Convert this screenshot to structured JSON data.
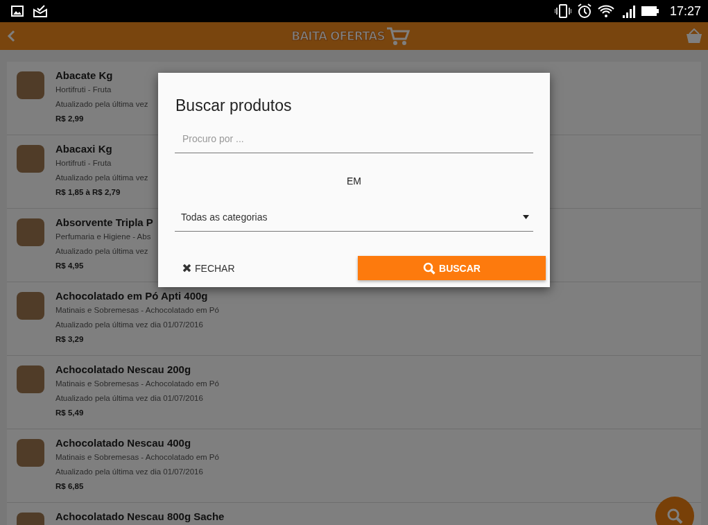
{
  "status_bar": {
    "time": "17:27"
  },
  "app_bar": {
    "logo": "BAITA OFERTAS"
  },
  "products": [
    {
      "name": "Abacate Kg",
      "category": "Hortifruti - Fruta",
      "updated": "Atualizado pela última vez",
      "price": "R$ 2,99"
    },
    {
      "name": "Abacaxi Kg",
      "category": "Hortifruti - Fruta",
      "updated": "Atualizado pela última vez",
      "price": "R$ 1,85 à R$ 2,79"
    },
    {
      "name": "Absorvente Tripla P",
      "category": "Perfumaria e Higiene - Abs",
      "updated": "Atualizado pela última vez",
      "price": "R$ 4,95"
    },
    {
      "name": "Achocolatado em Pó Apti 400g",
      "category": "Matinais e Sobremesas - Achocolatado em Pó",
      "updated": "Atualizado pela última vez dia 01/07/2016",
      "price": "R$ 3,29"
    },
    {
      "name": "Achocolatado Nescau 200g",
      "category": "Matinais e Sobremesas - Achocolatado em Pó",
      "updated": "Atualizado pela última vez dia 01/07/2016",
      "price": "R$ 5,49"
    },
    {
      "name": "Achocolatado Nescau 400g",
      "category": "Matinais e Sobremesas - Achocolatado em Pó",
      "updated": "Atualizado pela última vez dia 01/07/2016",
      "price": "R$ 6,85"
    },
    {
      "name": "Achocolatado Nescau 800g Sache"
    }
  ],
  "dialog": {
    "title": "Buscar produtos",
    "search": {
      "placeholder": "Procuro por ..."
    },
    "in_label": "EM",
    "category_select": {
      "value": "Todas as categorias"
    },
    "buttons": [
      {
        "kind": "flat",
        "label": "FECHAR"
      },
      {
        "kind": "raised",
        "label": "BUSCAR"
      }
    ]
  }
}
